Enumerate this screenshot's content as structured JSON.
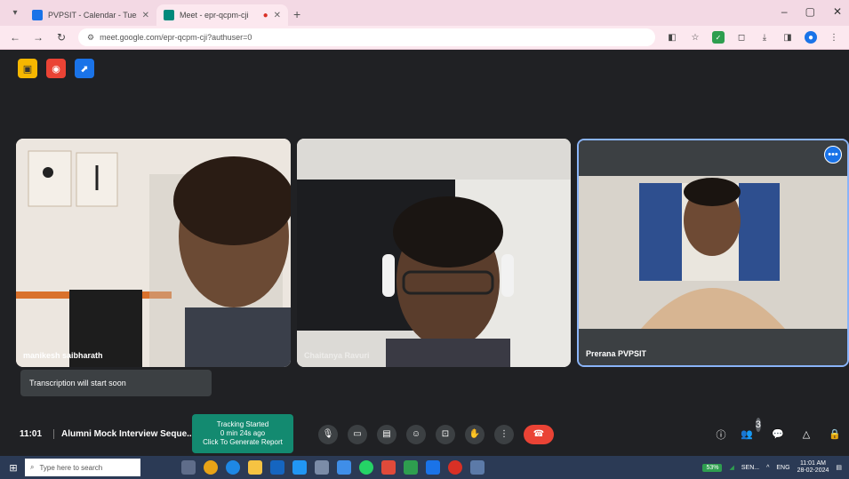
{
  "browser": {
    "tabs": [
      {
        "title": "PVPSIT - Calendar - Tuesday, F",
        "favicon_color": "#1a73e8",
        "active": false
      },
      {
        "title": "Meet - epr-qcpm-cji",
        "favicon_color": "#00897b",
        "active": true
      }
    ],
    "url": "meet.google.com/epr-qcpm-cji?authuser=0"
  },
  "meet": {
    "participants": [
      {
        "name": "manikesh saibharath"
      },
      {
        "name": "Chaitanya Ravuri"
      },
      {
        "name": "Prerana PVPSIT"
      }
    ],
    "caption_text": "Transcription will start soon",
    "clock": "11:01",
    "meeting_title": "Alumni Mock Interview Seque...",
    "tracking": {
      "line1": "Tracking Started",
      "line2": "0 min 24s ago",
      "line3": "Click To Generate Report"
    },
    "people_count": "3"
  },
  "taskbar": {
    "search_placeholder": "Type here to search",
    "battery": "53%",
    "sensex": "SEN...",
    "language": "ENG",
    "time": "11:01 AM",
    "date": "28-02-2024"
  }
}
